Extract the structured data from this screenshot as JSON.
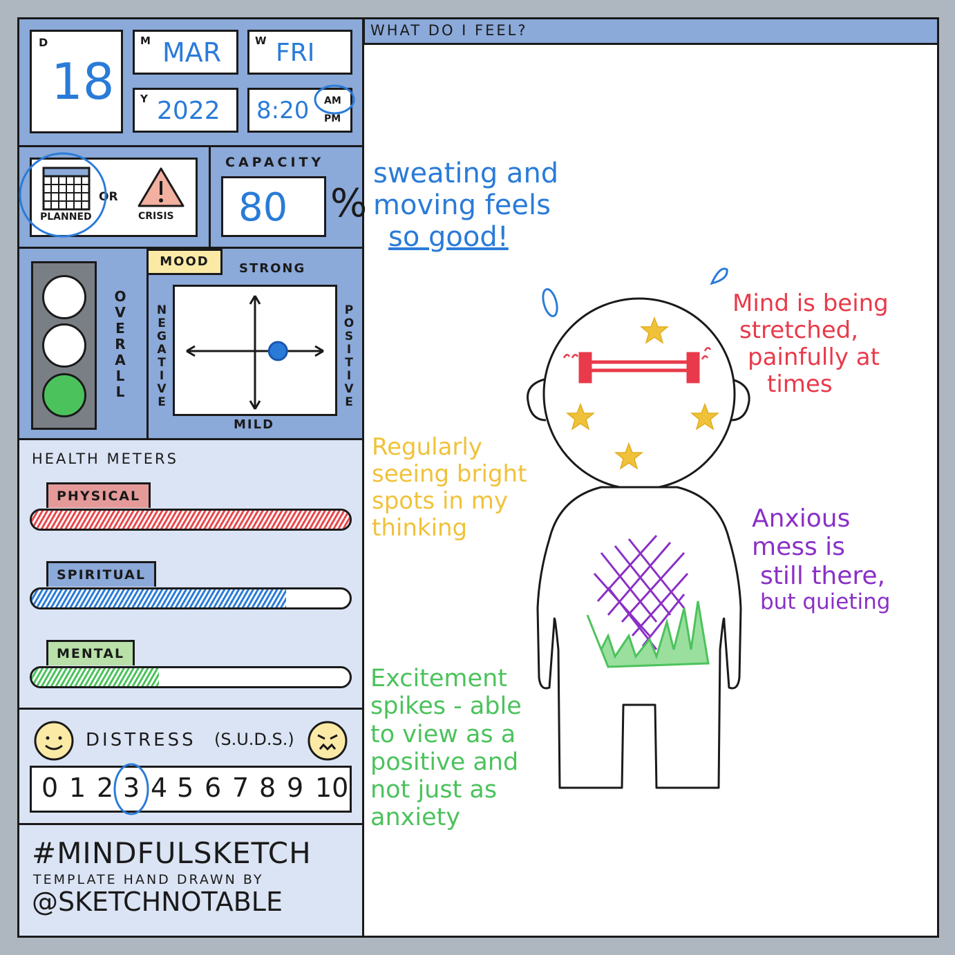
{
  "header": {
    "day_label": "D",
    "day": "18",
    "month_label": "M",
    "month": "MAR",
    "weekday_label": "W",
    "weekday": "FRI",
    "year_label": "Y",
    "year": "2022",
    "time": "8:20",
    "am": "AM",
    "pm": "PM",
    "ampm_selected": "AM"
  },
  "plan": {
    "planned": "PLANNED",
    "or": "OR",
    "crisis": "CRISIS",
    "selected": "planned",
    "crisis_icon": "warning-icon",
    "planned_icon": "calendar-icon"
  },
  "capacity": {
    "title": "CAPACITY",
    "value": "80",
    "unit": "%"
  },
  "mood": {
    "overall": "OVERALL",
    "overall_light": "green",
    "tag": "MOOD",
    "strong": "STRONG",
    "mild": "MILD",
    "negative": "NEGATIVE",
    "positive": "POSITIVE",
    "mark_x": 0.35,
    "mark_y": 0.0
  },
  "health": {
    "title": "HEALTH METERS",
    "meters": [
      {
        "label": "PHYSICAL",
        "level": 1.0,
        "tag_color": "#e59a9a",
        "fill_color": "#e8474c"
      },
      {
        "label": "SPIRITUAL",
        "level": 0.8,
        "tag_color": "#8ba9d9",
        "fill_color": "#2a7bd8"
      },
      {
        "label": "MENTAL",
        "level": 0.4,
        "tag_color": "#b8e0a8",
        "fill_color": "#4cc25c"
      }
    ]
  },
  "distress": {
    "title": "DISTRESS",
    "subtitle": "(S.U.D.S.)",
    "scale": [
      "0",
      "1",
      "2",
      "3",
      "4",
      "5",
      "6",
      "7",
      "8",
      "9",
      "10"
    ],
    "selected": "3",
    "happy_icon": "smiley-icon",
    "sad_icon": "angry-face-icon"
  },
  "footer": {
    "hashtag": "#MINDFULSKETCH",
    "credit": "TEMPLATE HAND DRAWN BY",
    "handle": "@SKETCHNOTABLE"
  },
  "feel": {
    "title": "WHAT DO I FEEL?",
    "notes": {
      "blue": [
        "sweating and",
        "moving feels",
        "so good!"
      ],
      "red": [
        "Mind is being",
        "stretched,",
        "painfully at",
        "times"
      ],
      "yellow": [
        "Regularly",
        "seeing bright",
        "spots in my",
        "thinking"
      ],
      "purple": [
        "Anxious",
        "mess is",
        "still there,",
        "but quieting"
      ],
      "green": [
        "Excitement",
        "spikes - able",
        "to view as a",
        "positive and",
        "not just as",
        "anxiety"
      ]
    },
    "colors": {
      "blue": "#2a7bd8",
      "red": "#e83a4a",
      "yellow": "#f0c23a",
      "purple": "#8a30c6",
      "green": "#4cc25c"
    }
  }
}
